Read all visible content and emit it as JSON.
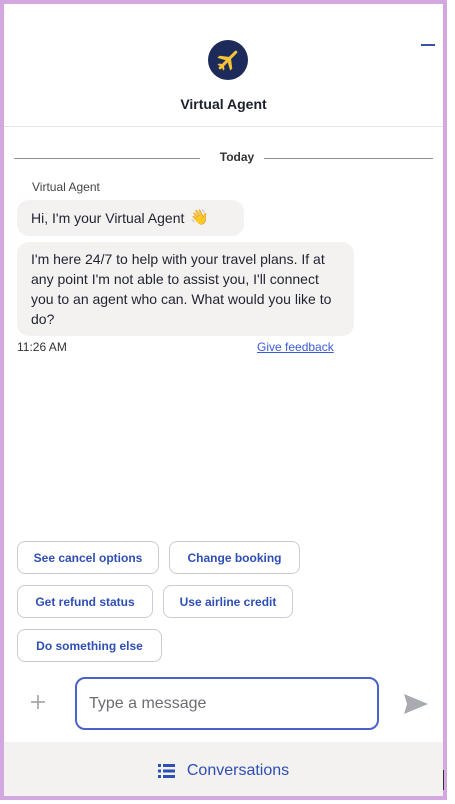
{
  "header": {
    "title": "Virtual Agent",
    "logo_icon": "airplane-logo-icon",
    "minimize_icon": "minimize-icon"
  },
  "conversation": {
    "day_label": "Today",
    "sender": "Virtual Agent",
    "messages": [
      {
        "text": "Hi, I'm your Virtual Agent",
        "emoji": "👋"
      },
      {
        "text": "I'm here 24/7 to help with your travel plans. If at any point I'm not able to assist you, I'll connect you to an agent who can. What would you like to do?"
      }
    ],
    "timestamp": "11:26 AM",
    "feedback_label": "Give feedback"
  },
  "quick_replies": [
    "See cancel options",
    "Change booking",
    "Get refund status",
    "Use airline credit",
    "Do something else"
  ],
  "composer": {
    "placeholder": "Type a message",
    "value": "",
    "add_icon": "plus-icon",
    "send_icon": "send-icon"
  },
  "footer": {
    "label": "Conversations",
    "icon": "list-icon"
  },
  "colors": {
    "accent": "#2e4fb3",
    "border_focus": "#4a63c9",
    "bubble_bg": "#f4f1f1",
    "logo_bg": "#1c2b5a",
    "logo_plane": "#f5c335",
    "frame": "#d3a8e0"
  }
}
